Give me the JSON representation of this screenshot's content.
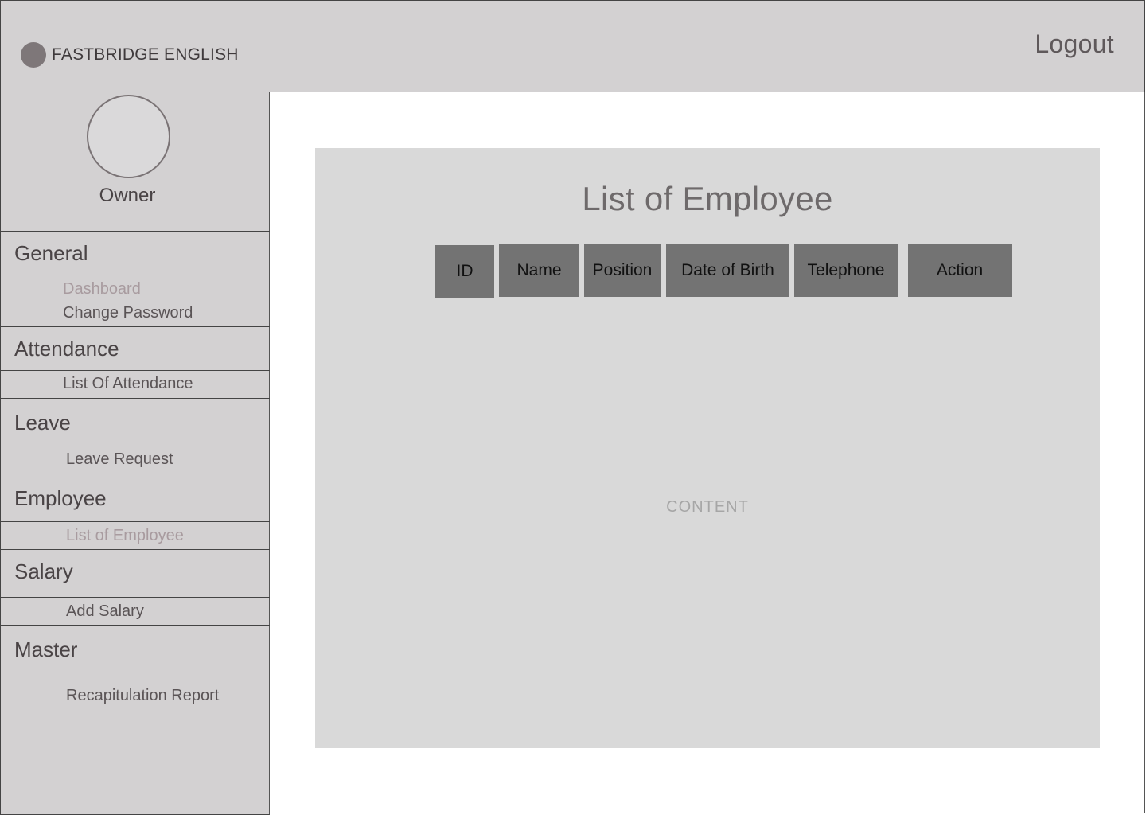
{
  "brand": {
    "name": "FASTBRIDGE ENGLISH"
  },
  "user": {
    "role": "Owner"
  },
  "header": {
    "logout_label": "Logout"
  },
  "sidebar": {
    "general": {
      "label": "General",
      "items": [
        "Dashboard",
        "Change Password"
      ]
    },
    "attendance": {
      "label": "Attendance",
      "items": [
        "List Of Attendance"
      ]
    },
    "leave": {
      "label": "Leave",
      "items": [
        "Leave Request"
      ]
    },
    "employee": {
      "label": "Employee",
      "items": [
        "List of Employee"
      ]
    },
    "salary": {
      "label": "Salary",
      "items": [
        "Add Salary"
      ]
    },
    "master": {
      "label": "Master",
      "items": [
        "Recapitulation Report"
      ]
    }
  },
  "main": {
    "title": "List of Employee",
    "columns": [
      "ID",
      "Name",
      "Position",
      "Date of Birth",
      "Telephone",
      "Action"
    ],
    "placeholder": "CONTENT"
  },
  "colors": {
    "panel_bg": "#d3d1d2",
    "content_bg": "#d9d9d9",
    "column_header_bg": "#737373",
    "muted_text": "#a89b9f"
  }
}
